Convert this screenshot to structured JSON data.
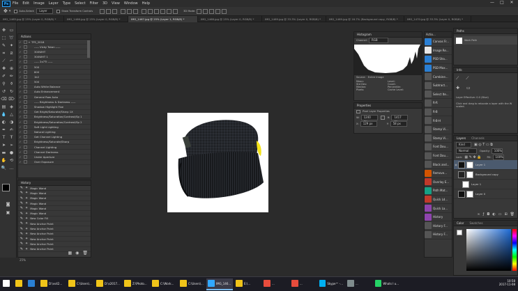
{
  "menu": {
    "logo": "Ps",
    "items": [
      "File",
      "Edit",
      "Image",
      "Layer",
      "Type",
      "Select",
      "Filter",
      "3D",
      "View",
      "Window",
      "Help"
    ],
    "window_controls": [
      "—",
      "□",
      "✕"
    ]
  },
  "options": {
    "auto_select_label": "Auto-Select:",
    "auto_select_value": "Layer",
    "show_transform_label": "Show Transform Controls",
    "mode_3d": "3D Mode:"
  },
  "tabs": [
    {
      "label": "IMG_1465.jpg @ 25% (Layer 0, RGB/8) *",
      "active": false
    },
    {
      "label": "IMG_1466.jpg @ 25% (Layer 0, RGB/8) *",
      "active": false
    },
    {
      "label": "IMG_1467.jpg @ 25% (Layer 1, RGB/8) *",
      "active": true
    },
    {
      "label": "IMG_1468.jpg @ 25% (Layer 0, RGB/8) *",
      "active": false
    },
    {
      "label": "IMG_1469.jpg @ 33.3% (Layer 0, RGB/8) *",
      "active": false
    },
    {
      "label": "IMG_1469.jpg @ 16.7% (Background copy, RGB/8) *",
      "active": false
    },
    {
      "label": "IMG_1470.jpg @ 33.3% (Layer 0, RGB/8) *",
      "active": false
    }
  ],
  "actions_panel": {
    "title": "Actions",
    "items": [
      "TFS_2018",
      "----- Vicky Tuton -----",
      "300WHT",
      "300WHT 1",
      "----- 2x7Ti -----",
      "500",
      "800",
      "1k2",
      "500",
      "Auto White Balance",
      "Auto Enhancement",
      "General Raw Auto",
      "----- Brightness & Darkness -----",
      "Shadow Highlight Fixe",
      "Get Bright/Saturate/Sharp 1X",
      "Brightness/Saturation/Contrast/Sp 1",
      "Brightness/Saturation/Contrast/Sp 2",
      "Soft Light Lighting",
      "Natural Lighting",
      "Get Channel Lighting",
      "Brightness/Saturate/Sharp",
      "Channel Lighting",
      "Channel Darkness",
      "Under Aperture",
      "Over Exposure"
    ]
  },
  "history_panel": {
    "title": "History",
    "items": [
      "Magic Wand",
      "Magic Wand",
      "Magic Wand",
      "Magic Wand",
      "Magic Wand",
      "Magic Wand",
      "New Color Fill",
      "New Anchor Point",
      "New Anchor Point",
      "New Anchor Point",
      "New Anchor Point",
      "New Anchor Point",
      "New Anchor Point"
    ]
  },
  "histogram_panel": {
    "title": "Histogram",
    "channel_label": "Channel:",
    "channel_value": "RGB",
    "source_label": "Source:",
    "source_value": "Entire Image",
    "stats_left": [
      "Mean:",
      "Std Dev:",
      "Median:",
      "Pixels:"
    ],
    "stats_right": [
      "Level:",
      "Count:",
      "Percentile:",
      "Cache Level:"
    ]
  },
  "properties_panel": {
    "title": "Properties",
    "subtitle": "Pixel Layer Properties",
    "w_label": "W:",
    "w_value": "1240 px",
    "h_label": "H:",
    "h_value": "1417 px",
    "x_label": "X:",
    "x_value": "129 px",
    "y_label": "Y:",
    "y_value": "58 px"
  },
  "actions_list": {
    "title": "Actio...",
    "items": [
      {
        "label": "Canvas Fr...",
        "color": "#2a7fd4"
      },
      {
        "label": "Image Re...",
        "color": "#e8e8e8"
      },
      {
        "label": "PSD Sha...",
        "color": "#2a7fd4"
      },
      {
        "label": "PSD Max...",
        "color": "#2a7fd4"
      },
      {
        "label": "Combine...",
        "color": "#555"
      },
      {
        "label": "Subtract...",
        "color": "#555"
      },
      {
        "label": "Select Ite...",
        "color": "#555"
      },
      {
        "label": "R-R",
        "color": "#555"
      },
      {
        "label": "R-B",
        "color": "#555"
      },
      {
        "label": "R-B-H",
        "color": "#555"
      },
      {
        "label": "Stamp Vi...",
        "color": "#555"
      },
      {
        "label": "Stamp Vi...",
        "color": "#555"
      },
      {
        "label": "Font Dou...",
        "color": "#555"
      },
      {
        "label": "Font Dou...",
        "color": "#555"
      },
      {
        "label": "Black and...",
        "color": "#555"
      },
      {
        "label": "Remove...",
        "color": "#d35400"
      },
      {
        "label": "Overlay E...",
        "color": "#c0392b"
      },
      {
        "label": "Path Mat...",
        "color": "#16a085"
      },
      {
        "label": "Quick Ld...",
        "color": "#c0392b"
      },
      {
        "label": "Quick La...",
        "color": "#8e44ad"
      },
      {
        "label": "History",
        "color": "#8e44ad"
      },
      {
        "label": "History F...",
        "color": "#555"
      },
      {
        "label": "History F...",
        "color": "#555"
      }
    ]
  },
  "paths_panel": {
    "title": "Paths",
    "item": "Work Path"
  },
  "info_panel": {
    "title": "Info",
    "note": "Layer Effective: 0.0 (Blue)",
    "hint": "Click and drag to relocate a layer with the W scaled."
  },
  "layers_panel": {
    "title": "Layers",
    "tab2": "Channels",
    "kind": "Kind",
    "blend": "Normal",
    "opacity_label": "Opacity:",
    "opacity": "100%",
    "lock_label": "Lock:",
    "fill_label": "Fill:",
    "fill": "100%",
    "layers": [
      "Layer 1",
      "Background copy",
      "Layer 1",
      "Layer 0"
    ]
  },
  "color_panel": {
    "title": "Color",
    "tab2": "Swatches"
  },
  "status": {
    "zoom": "25%",
    "doc": "Doc: 2.14M/13.1M"
  },
  "taskbar": {
    "items": [
      {
        "label": "",
        "color": "#ffffff",
        "active": false
      },
      {
        "label": "",
        "color": "#f0c419",
        "active": false
      },
      {
        "label": "",
        "color": "#2a7fd4",
        "active": false
      },
      {
        "label": "D:\\vs42...",
        "color": "#f0c419",
        "active": false
      },
      {
        "label": "C:\\Users\\...",
        "color": "#f0c419",
        "active": false
      },
      {
        "label": "D:\\s2017...",
        "color": "#f0c419",
        "active": false
      },
      {
        "label": "Z:\\Photo...",
        "color": "#f0c419",
        "active": false
      },
      {
        "label": "C:\\Work...",
        "color": "#f0c419",
        "active": false
      },
      {
        "label": "C:\\Users\\...",
        "color": "#f0c419",
        "active": false
      },
      {
        "label": "IMG_146...",
        "color": "#31a8ff",
        "active": true
      },
      {
        "label": "E:\\...",
        "color": "#f0c419",
        "active": false
      },
      {
        "label": "...",
        "color": "#e74c3c",
        "active": false
      },
      {
        "label": "...",
        "color": "#e74c3c",
        "active": false
      },
      {
        "label": "Skype™ -...",
        "color": "#00aff0",
        "active": false
      },
      {
        "label": "...",
        "color": "#7f8c8d",
        "active": false
      },
      {
        "label": "Whats I u...",
        "color": "#25d366",
        "active": false
      }
    ],
    "clock_time": "10:58",
    "clock_date": "2017-11-08"
  }
}
